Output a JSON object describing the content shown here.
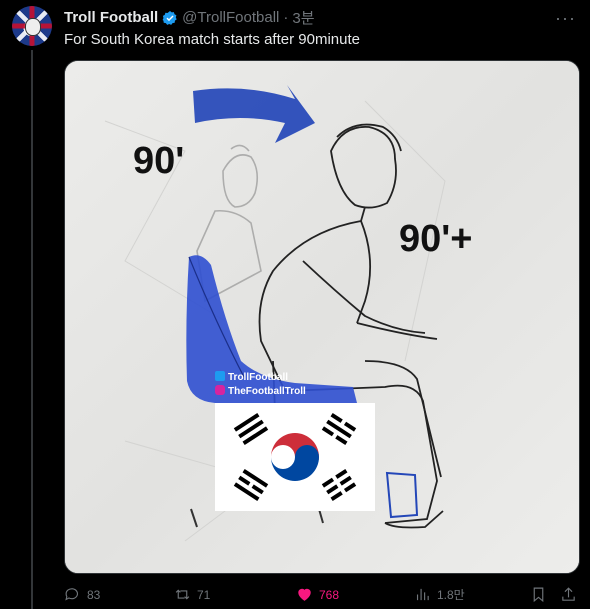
{
  "tweet": {
    "author_name": "Troll Football",
    "handle": "@TrollFootball",
    "separator": "·",
    "time": "3분",
    "text": "For South Korea match starts after 90minute",
    "more_label": "···",
    "verified_color": "#1d9bf0"
  },
  "media": {
    "label_left": "90'",
    "label_right": "90'+",
    "watermark_twitter": "TrollFootball",
    "watermark_instagram": "TheFootballTroll",
    "arrow_color": "#2447b8",
    "seat_color": "#2f4fd0"
  },
  "actions": {
    "replies": "83",
    "retweets": "71",
    "likes": "768",
    "views": "1.8만",
    "like_color": "#f91880"
  },
  "icons": [
    "reply-icon",
    "retweet-icon",
    "heart-icon",
    "views-icon",
    "bookmark-icon",
    "share-icon",
    "verified-badge-icon",
    "more-icon"
  ]
}
